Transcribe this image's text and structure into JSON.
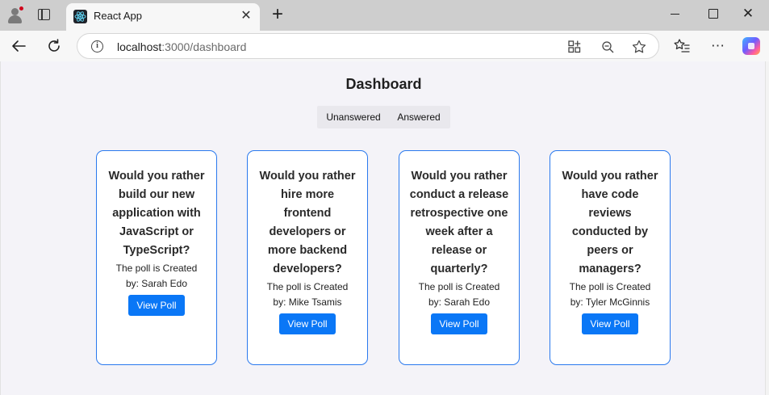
{
  "browser": {
    "tab_title": "React App",
    "url_host": "localhost",
    "url_rest": ":3000/dashboard"
  },
  "dashboard": {
    "title": "Dashboard",
    "filters": [
      "Unanswered",
      "Answered"
    ]
  },
  "polls": [
    {
      "question": "Would you rather build our new application with JavaScript or TypeScript?",
      "created_by": "The poll is Created by: Sarah Edo",
      "button": "View Poll"
    },
    {
      "question": "Would you rather hire more frontend developers or more backend developers?",
      "created_by": "The poll is Created by: Mike Tsamis",
      "button": "View Poll"
    },
    {
      "question": "Would you rather conduct a release retrospective one week after a release or quarterly?",
      "created_by": "The poll is Created by: Sarah Edo",
      "button": "View Poll"
    },
    {
      "question": "Would you rather have code reviews conducted by peers or managers?",
      "created_by": "The poll is Created by: Tyler McGinnis",
      "button": "View Poll"
    }
  ]
}
